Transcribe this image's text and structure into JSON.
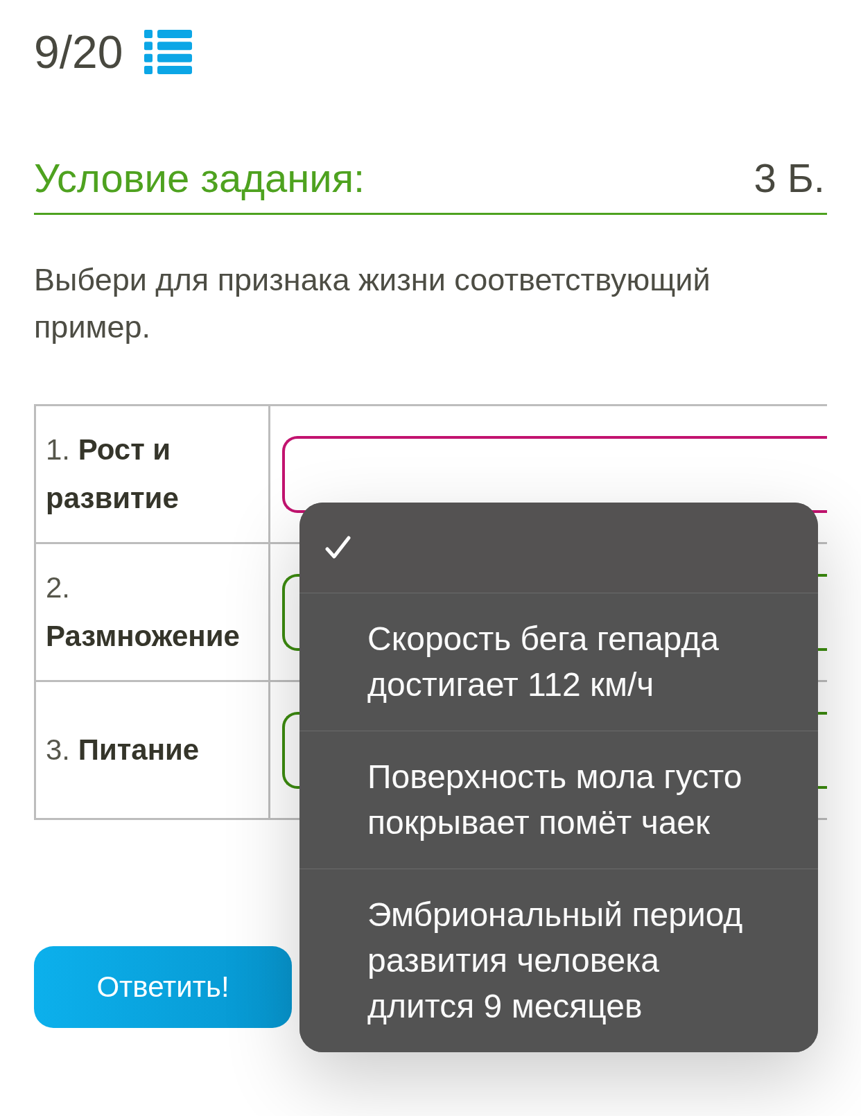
{
  "progress": {
    "counter": "9/20"
  },
  "task": {
    "heading": "Условие задания:",
    "points": "3 Б."
  },
  "instruction": "Выбери для признака жизни соответствующий пример.",
  "matching_rows": [
    {
      "label": "1. **Рост и развитие**",
      "active": true
    },
    {
      "label": "2. **Размножение**",
      "active": false
    },
    {
      "label": "3. **Питание**",
      "active": false
    }
  ],
  "dropdown": {
    "options": [
      {
        "selected": true
      },
      {
        "label": "Скорость бега гепарда достигает 112 км/ч",
        "selected": false
      },
      {
        "label": "Поверхность мола густо покрывает помёт чаек",
        "selected": false
      },
      {
        "label": "Эмбриональный период развития человека длится 9 месяцев",
        "selected": false
      }
    ]
  },
  "submit_button": {
    "label": "Ответить!"
  }
}
